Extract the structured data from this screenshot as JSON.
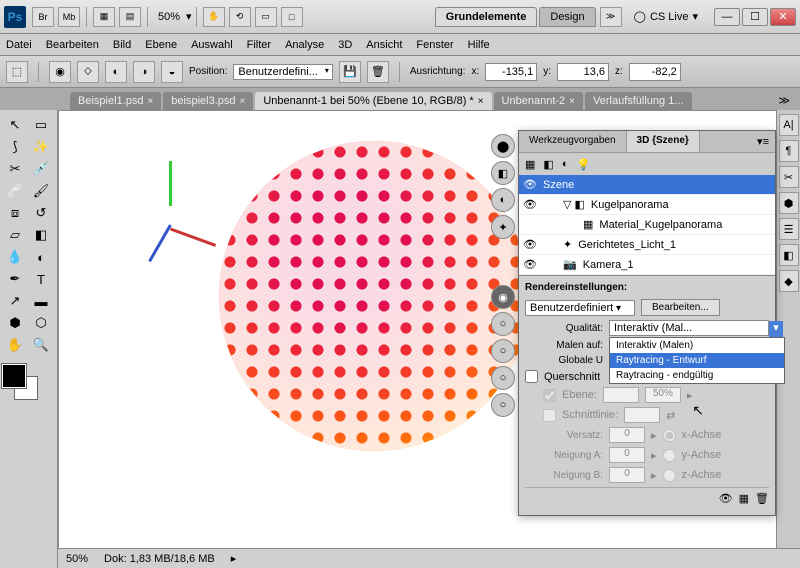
{
  "app": {
    "zoom": "50%"
  },
  "workspace": {
    "tabs": [
      "Grundelemente",
      "Design"
    ],
    "cslive": "CS Live"
  },
  "menu": [
    "Datei",
    "Bearbeiten",
    "Bild",
    "Ebene",
    "Auswahl",
    "Filter",
    "Analyse",
    "3D",
    "Ansicht",
    "Fenster",
    "Hilfe"
  ],
  "options": {
    "position_label": "Position:",
    "position_preset": "Benutzerdefini...",
    "align_label": "Ausrichtung:",
    "x_lbl": "x:",
    "x_val": "-135,1",
    "y_lbl": "y:",
    "y_val": "13,6",
    "z_lbl": "z:",
    "z_val": "-82,2"
  },
  "docs": [
    {
      "label": "Beispiel1.psd",
      "active": false
    },
    {
      "label": "beispiel3.psd",
      "active": false
    },
    {
      "label": "Unbenannt-1 bei 50% (Ebene 10, RGB/8) *",
      "active": true
    },
    {
      "label": "Unbenannt-2",
      "active": false
    },
    {
      "label": "Verlaufsfüllung 1...",
      "active": false
    }
  ],
  "status": {
    "zoom": "50%",
    "doc": "Dok: 1,83 MB/18,6 MB"
  },
  "panel3d": {
    "tabs": [
      "Werkzeugvorgaben",
      "3D {Szene}"
    ],
    "scene_items": [
      {
        "label": "Szene",
        "sel": true,
        "indent": 0,
        "icon": ""
      },
      {
        "label": "Kugelpanorama",
        "sel": false,
        "indent": 1,
        "icon": "▽ ◧"
      },
      {
        "label": "Material_Kugelpanorama",
        "sel": false,
        "indent": 2,
        "icon": "▦"
      },
      {
        "label": "Gerichtetes_Licht_1",
        "sel": false,
        "indent": 1,
        "icon": "✦"
      },
      {
        "label": "Kamera_1",
        "sel": false,
        "indent": 1,
        "icon": "📷"
      }
    ]
  },
  "render": {
    "title": "Rendereinstellungen:",
    "preset": "Benutzerdefiniert",
    "edit": "Bearbeiten...",
    "quality_lbl": "Qualität:",
    "quality_val": "Interaktiv (Mal...",
    "paint_lbl": "Malen auf:",
    "globals_lbl": "Globale U",
    "dropdown": [
      "Interaktiv (Malen)",
      "Raytracing - Entwurf",
      "Raytracing - endgültig"
    ],
    "cross": "Querschnitt",
    "ebene": "Ebene:",
    "fifty": "50%",
    "schnitt": "Schnittlinie:",
    "versatz": "Versatz:",
    "neigA": "Neigung A:",
    "neigB": "Neigung B:",
    "zero": "0",
    "xachse": "x-Achse",
    "yachse": "y-Achse",
    "zachse": "z-Achse"
  }
}
